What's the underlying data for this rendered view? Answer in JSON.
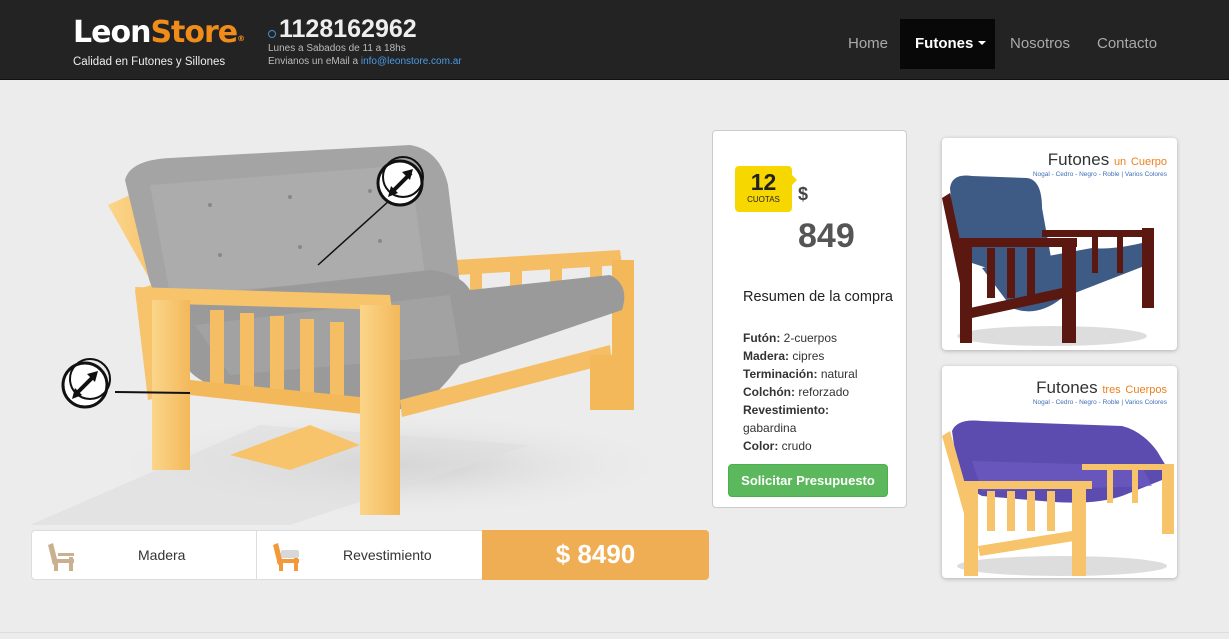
{
  "header": {
    "logo_part1": "Leon",
    "logo_part2": "Store",
    "logo_mark": "®",
    "tagline": "Calidad en Futones y Sillones",
    "phone": "1128162962",
    "hours": "Lunes a Sabados de 11 a 18hs",
    "email_prefix": "Envianos un eMail a ",
    "email": "info@leonstore.com.ar",
    "phone_icon": "whatsapp-icon"
  },
  "nav": {
    "items": [
      {
        "label": "Home"
      },
      {
        "label": "Futones"
      },
      {
        "label": "Nosotros"
      },
      {
        "label": "Contacto"
      }
    ],
    "active_item": "Futones"
  },
  "options": {
    "wood_label": "Madera",
    "covering_label": "Revestimiento",
    "total": "$ 8490"
  },
  "summary": {
    "installments_count": "12",
    "installments_label": "CUOTAS",
    "currency": "$",
    "installment_price": "849",
    "title": "Resumen de la compra",
    "specs": [
      {
        "label": "Futón:",
        "value": "2-cuerpos"
      },
      {
        "label": "Madera:",
        "value": "cipres"
      },
      {
        "label": "Terminación:",
        "value": "natural"
      },
      {
        "label": "Colchón:",
        "value": "reforzado"
      },
      {
        "label": "Revestimiento:",
        "value": "gabardina"
      },
      {
        "label": "Color:",
        "value": "crudo"
      }
    ],
    "button_label": "Solicitar Presupuesto"
  },
  "thumbnails": [
    {
      "title": "Futones",
      "accent_word": "un",
      "accent_word2": "Cuerpo",
      "subtitle": "Nogal - Cedro - Negro - Roble | Varios Colores"
    },
    {
      "title": "Futones",
      "accent_word": "tres",
      "accent_word2": "Cuerpos",
      "subtitle": "Nogal - Cedro - Negro - Roble | Varios Colores"
    }
  ],
  "colors": {
    "header_bg": "#232323",
    "accent_orange": "#efad54",
    "brand_orange": "#f08c1a",
    "button_green": "#5cb85c",
    "badge_yellow": "#f7d700",
    "wood": "#f7c36b",
    "mattress_grey": "#9a9a9a",
    "thumb1_mattress": "#3e5b86",
    "thumb2_mattress": "#5d4cb0"
  }
}
